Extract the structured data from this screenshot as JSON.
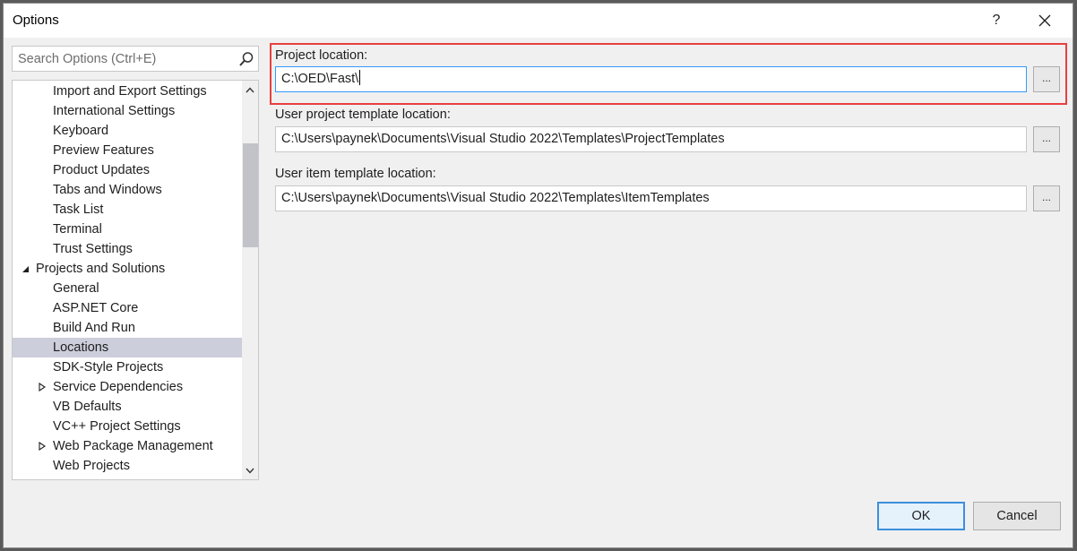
{
  "window": {
    "title": "Options",
    "help_label": "?"
  },
  "search": {
    "placeholder": "Search Options (Ctrl+E)",
    "icon": "search-icon"
  },
  "tree": {
    "items": [
      {
        "label": "Import and Export Settings",
        "level": 2
      },
      {
        "label": "International Settings",
        "level": 2
      },
      {
        "label": "Keyboard",
        "level": 2
      },
      {
        "label": "Preview Features",
        "level": 2
      },
      {
        "label": "Product Updates",
        "level": 2
      },
      {
        "label": "Tabs and Windows",
        "level": 2
      },
      {
        "label": "Task List",
        "level": 2
      },
      {
        "label": "Terminal",
        "level": 2
      },
      {
        "label": "Trust Settings",
        "level": 2
      },
      {
        "label": "Projects and Solutions",
        "level": 1,
        "expander": "expanded"
      },
      {
        "label": "General",
        "level": 2
      },
      {
        "label": "ASP.NET Core",
        "level": 2
      },
      {
        "label": "Build And Run",
        "level": 2
      },
      {
        "label": "Locations",
        "level": 2,
        "selected": true
      },
      {
        "label": "SDK-Style Projects",
        "level": 2
      },
      {
        "label": "Service Dependencies",
        "level": 2,
        "expander": "collapsed"
      },
      {
        "label": "VB Defaults",
        "level": 2
      },
      {
        "label": "VC++ Project Settings",
        "level": 2
      },
      {
        "label": "Web Package Management",
        "level": 2,
        "expander": "collapsed"
      },
      {
        "label": "Web Projects",
        "level": 2
      }
    ]
  },
  "fields": {
    "project_location": {
      "label": "Project location:",
      "value": "C:\\OED\\Fast\\"
    },
    "user_project_template": {
      "label": "User project template location:",
      "value": "C:\\Users\\paynek\\Documents\\Visual Studio 2022\\Templates\\ProjectTemplates"
    },
    "user_item_template": {
      "label": "User item template location:",
      "value": "C:\\Users\\paynek\\Documents\\Visual Studio 2022\\Templates\\ItemTemplates"
    },
    "browse_label": "..."
  },
  "buttons": {
    "ok": "OK",
    "cancel": "Cancel"
  },
  "colors": {
    "highlight": "#e83f3f",
    "selected_item": "#cccedb",
    "focus_border": "#3399ff"
  }
}
